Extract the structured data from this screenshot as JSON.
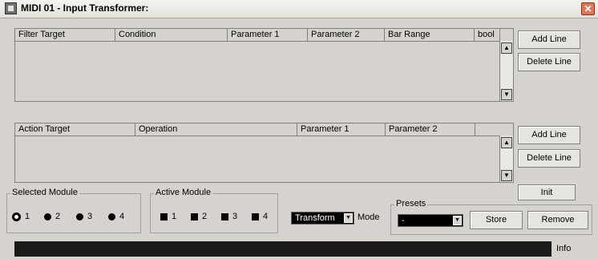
{
  "window": {
    "title": "MIDI 01 - Input Transformer:",
    "close_glyph": "✕"
  },
  "filter_table": {
    "columns": [
      "Filter Target",
      "Condition",
      "Parameter 1",
      "Parameter 2",
      "Bar Range",
      "bool"
    ],
    "rows": []
  },
  "action_table": {
    "columns": [
      "Action Target",
      "Operation",
      "Parameter 1",
      "Parameter 2"
    ],
    "rows": []
  },
  "filter_buttons": {
    "add": "Add Line",
    "delete": "Delete Line"
  },
  "action_buttons": {
    "add": "Add Line",
    "delete": "Delete Line"
  },
  "init_button": "Init",
  "selected_module": {
    "title": "Selected Module",
    "options": [
      "1",
      "2",
      "3",
      "4"
    ],
    "selected": "1"
  },
  "active_module": {
    "title": "Active Module",
    "options": [
      "1",
      "2",
      "3",
      "4"
    ]
  },
  "mode": {
    "value": "Transform",
    "label": "Mode"
  },
  "presets": {
    "title": "Presets",
    "value": "-",
    "store": "Store",
    "remove": "Remove"
  },
  "info": {
    "label": "Info"
  },
  "icons": {
    "scroll_up": "▲",
    "scroll_down": "▼",
    "dropdown": "▼"
  }
}
